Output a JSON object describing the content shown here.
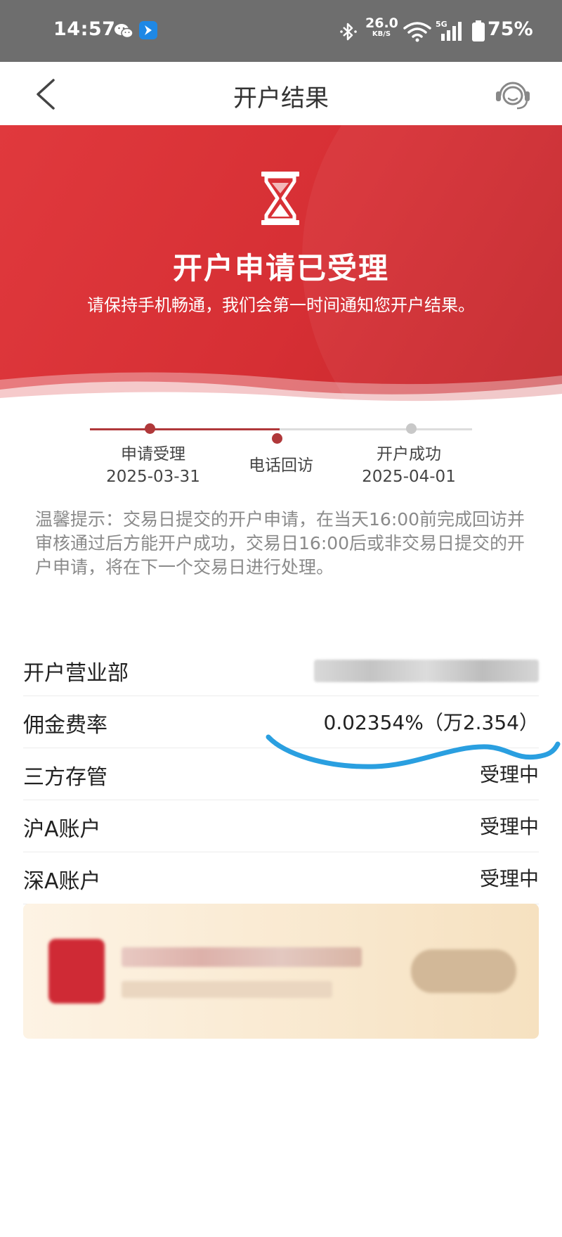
{
  "status_bar": {
    "time": "14:57",
    "net_speed_value": "26.0",
    "net_speed_unit": "KB/S",
    "network": "5G",
    "battery": "75%"
  },
  "nav": {
    "title": "开户结果"
  },
  "hero": {
    "title": "开户申请已受理",
    "subtitle": "请保持手机畅通，我们会第一时间通知您开户结果。"
  },
  "progress": {
    "steps": [
      {
        "label": "申请受理",
        "date": "2025-03-31",
        "state": "done"
      },
      {
        "label": "电话回访",
        "date": "",
        "state": "current"
      },
      {
        "label": "开户成功",
        "date": "2025-04-01",
        "state": "pending"
      }
    ]
  },
  "tip": "温馨提示：交易日提交的开户申请，在当天16:00前完成回访并审核通过后方能开户成功，交易日16:00后或非交易日提交的开户申请，将在下一个交易日进行处理。",
  "info_rows": [
    {
      "label": "开户营业部",
      "value": ""
    },
    {
      "label": "佣金费率",
      "value": "0.02354%（万2.354）"
    },
    {
      "label": "三方存管",
      "value": "受理中"
    },
    {
      "label": "沪A账户",
      "value": "受理中"
    },
    {
      "label": "深A账户",
      "value": "受理中"
    }
  ],
  "colors": {
    "brand_red": "#d62f34",
    "progress_done": "#b0383a",
    "progress_pending": "#c8c8c8",
    "tip_text": "#8a8a8a",
    "annotation_blue": "#2a9fe0"
  }
}
